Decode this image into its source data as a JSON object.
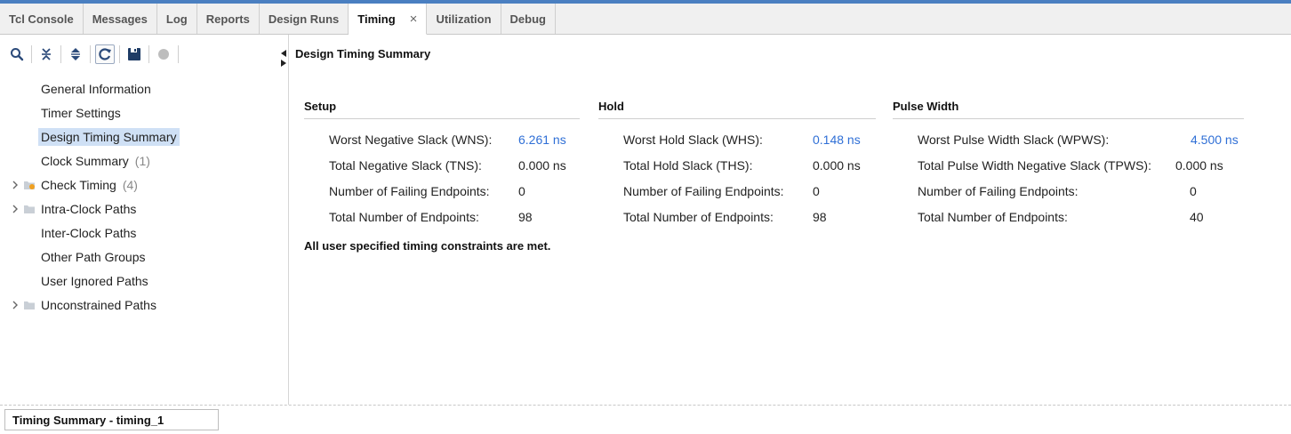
{
  "tabs": [
    {
      "label": "Tcl Console",
      "active": false
    },
    {
      "label": "Messages",
      "active": false
    },
    {
      "label": "Log",
      "active": false
    },
    {
      "label": "Reports",
      "active": false
    },
    {
      "label": "Design Runs",
      "active": false
    },
    {
      "label": "Timing",
      "active": true
    },
    {
      "label": "Utilization",
      "active": false
    },
    {
      "label": "Debug",
      "active": false
    }
  ],
  "toolbar": {
    "icons": [
      "search-icon",
      "collapse-all-icon",
      "expand-all-icon",
      "refresh-icon",
      "save-icon",
      "record-icon"
    ]
  },
  "tree": {
    "items": [
      {
        "label": "General Information",
        "count": "",
        "expandable": false,
        "selected": false
      },
      {
        "label": "Timer Settings",
        "count": "",
        "expandable": false,
        "selected": false
      },
      {
        "label": "Design Timing Summary",
        "count": "",
        "expandable": false,
        "selected": true
      },
      {
        "label": "Clock Summary",
        "count": "(1)",
        "expandable": false,
        "selected": false
      },
      {
        "label": "Check Timing",
        "count": "(4)",
        "expandable": true,
        "selected": false,
        "folder": "warning"
      },
      {
        "label": "Intra-Clock Paths",
        "count": "",
        "expandable": true,
        "selected": false,
        "folder": "plain"
      },
      {
        "label": "Inter-Clock Paths",
        "count": "",
        "expandable": false,
        "selected": false
      },
      {
        "label": "Other Path Groups",
        "count": "",
        "expandable": false,
        "selected": false
      },
      {
        "label": "User Ignored Paths",
        "count": "",
        "expandable": false,
        "selected": false
      },
      {
        "label": "Unconstrained Paths",
        "count": "",
        "expandable": true,
        "selected": false,
        "folder": "plain"
      }
    ]
  },
  "main": {
    "title": "Design Timing Summary",
    "setup": {
      "title": "Setup",
      "rows": [
        {
          "key": "Worst Negative Slack (WNS):",
          "value": "6.261 ns",
          "link": true
        },
        {
          "key": "Total Negative Slack (TNS):",
          "value": "0.000 ns",
          "link": false
        },
        {
          "key": "Number of Failing Endpoints:",
          "value": "0",
          "link": false
        },
        {
          "key": "Total Number of Endpoints:",
          "value": "98",
          "link": false
        }
      ]
    },
    "hold": {
      "title": "Hold",
      "rows": [
        {
          "key": "Worst Hold Slack (WHS):",
          "value": "0.148 ns",
          "link": true
        },
        {
          "key": "Total Hold Slack (THS):",
          "value": "0.000 ns",
          "link": false
        },
        {
          "key": "Number of Failing Endpoints:",
          "value": "0",
          "link": false
        },
        {
          "key": "Total Number of Endpoints:",
          "value": "98",
          "link": false
        }
      ]
    },
    "pulse": {
      "title": "Pulse Width",
      "rows": [
        {
          "key": "Worst Pulse Width Slack (WPWS):",
          "value": "4.500 ns",
          "link": true
        },
        {
          "key": "Total Pulse Width Negative Slack (TPWS):",
          "value": "0.000 ns",
          "link": false
        },
        {
          "key": "Number of Failing Endpoints:",
          "value": "0",
          "link": false
        },
        {
          "key": "Total Number of Endpoints:",
          "value": "40",
          "link": false
        }
      ]
    },
    "status": "All user specified timing constraints are met."
  },
  "bottom_tab": "Timing Summary - timing_1",
  "colors": {
    "accent": "#4a7fc1",
    "link": "#2f6fd6",
    "selected": "#cfe0f5"
  }
}
